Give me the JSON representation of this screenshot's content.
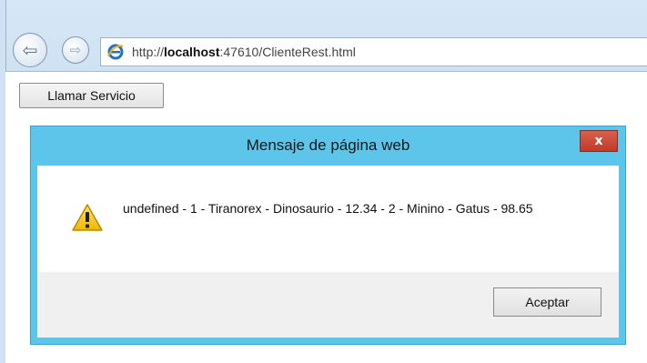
{
  "browser": {
    "url_prefix": "http://",
    "url_host": "localhost",
    "url_rest": ":47610/ClienteRest.html",
    "back_icon": "back-arrow-icon",
    "forward_icon": "forward-arrow-icon",
    "site_icon": "ie-page-icon"
  },
  "page": {
    "button_label": "Llamar Servicio"
  },
  "dialog": {
    "title": "Mensaje de página web",
    "close_label": "x",
    "message": "undefined - 1 - Tiranorex - Dinosaurio - 12.34 - 2 - Minino - Gatus - 98.65",
    "icon": "warning-icon",
    "ok_label": "Aceptar",
    "accent_color": "#5ec5ea"
  }
}
